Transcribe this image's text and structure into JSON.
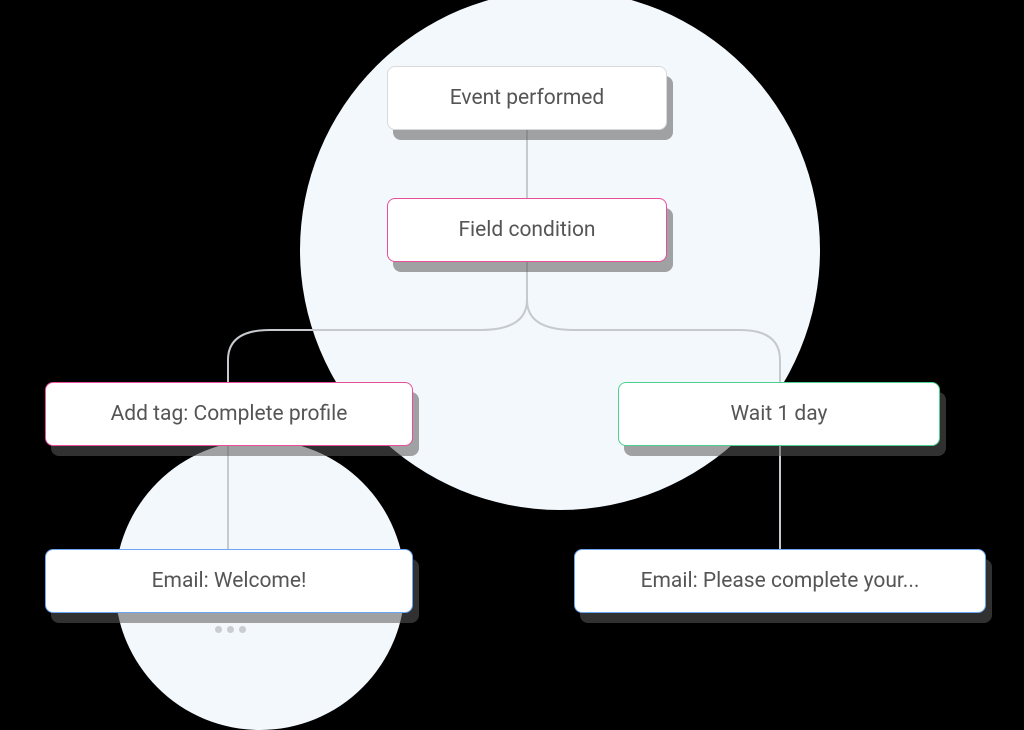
{
  "workflow": {
    "trigger": {
      "label": "Event performed"
    },
    "condition": {
      "label": "Field condition"
    },
    "branches": {
      "left": {
        "action_tag": {
          "label": "Add tag: Complete profile"
        },
        "action_email": {
          "label": "Email: Welcome!"
        }
      },
      "right": {
        "action_wait": {
          "label": "Wait 1 day"
        },
        "action_email": {
          "label": "Email: Please complete your..."
        }
      }
    }
  },
  "colors": {
    "condition_border": "#e94e9c",
    "wait_border": "#4dd18f",
    "email_border": "#6aa6f2",
    "connector": "#c6c9cd",
    "bg_circle": "#f3f8fc"
  }
}
